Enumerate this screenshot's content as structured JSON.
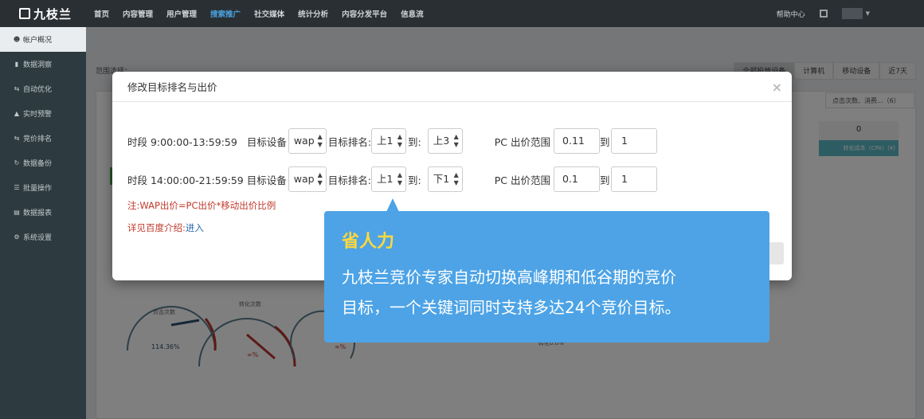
{
  "app": {
    "logo": "九枝兰"
  },
  "nav": {
    "items": [
      "首页",
      "内容管理",
      "用户管理",
      "搜索推广",
      "社交媒体",
      "统计分析",
      "内容分发平台",
      "信息流"
    ],
    "active_index": 3,
    "help": "帮助中心"
  },
  "sidebar": {
    "items": [
      {
        "icon": "users-icon",
        "label": "帐户概况",
        "active": true
      },
      {
        "icon": "bar-chart-icon",
        "label": "数据洞察"
      },
      {
        "icon": "swap-icon",
        "label": "自动优化"
      },
      {
        "icon": "warning-icon",
        "label": "实时预警"
      },
      {
        "icon": "swap-icon",
        "label": "竞价排名"
      },
      {
        "icon": "refresh-icon",
        "label": "数据备份"
      },
      {
        "icon": "list-icon",
        "label": "批量操作"
      },
      {
        "icon": "report-icon",
        "label": "数据报表"
      },
      {
        "icon": "gear-icon",
        "label": "系统设置"
      }
    ]
  },
  "background": {
    "range_label": "范围选择：",
    "segments": [
      "全部投放设备",
      "计算机",
      "移动设备",
      "近7天"
    ],
    "right_select": "点击次数、消费...（6）",
    "stat_value": "0",
    "stat_label": "转化成本（CPA）(¥)",
    "gauge_label": "转化0.0%",
    "gauge1_label": "点击次数",
    "gauge1_value": "114.36%",
    "gauge2_label": "转化次数",
    "gauge2_value": "∞%",
    "gauge3_value": "∞%"
  },
  "modal": {
    "title": "修改目标排名与出价",
    "close": "×",
    "rows": [
      {
        "period": "时段 9:00:00-13:59:59",
        "device_label": "目标设备",
        "device": "wap",
        "rank_label": "目标排名:",
        "rank_from": "上1",
        "to_label": "到:",
        "rank_to": "上3",
        "pc_label": "PC 出价范围",
        "bid_min": "0.11",
        "to2": "到",
        "bid_max": "1"
      },
      {
        "period": "时段 14:00:00-21:59:59",
        "device_label": "目标设备",
        "device": "wap",
        "rank_label": "目标排名:",
        "rank_from": "上1",
        "to_label": "到:",
        "rank_to": "下1",
        "pc_label": "PC 出价范围",
        "bid_min": "0.1",
        "to2": "到",
        "bid_max": "1"
      }
    ],
    "note": "注:WAP出价=PC出价*移动出价比例",
    "detail_prefix": "详见百度介绍:",
    "detail_link": "进入"
  },
  "callout": {
    "title": "省人力",
    "body_line1": "九枝兰竞价专家自动切换高峰期和低谷期的竞价",
    "body_line2": "目标，一个关键词同时支持多达24个竞价目标。"
  },
  "colors": {
    "callout_bg": "#4da3e6",
    "callout_title": "#ffd93b",
    "accent": "#4aa3df"
  }
}
